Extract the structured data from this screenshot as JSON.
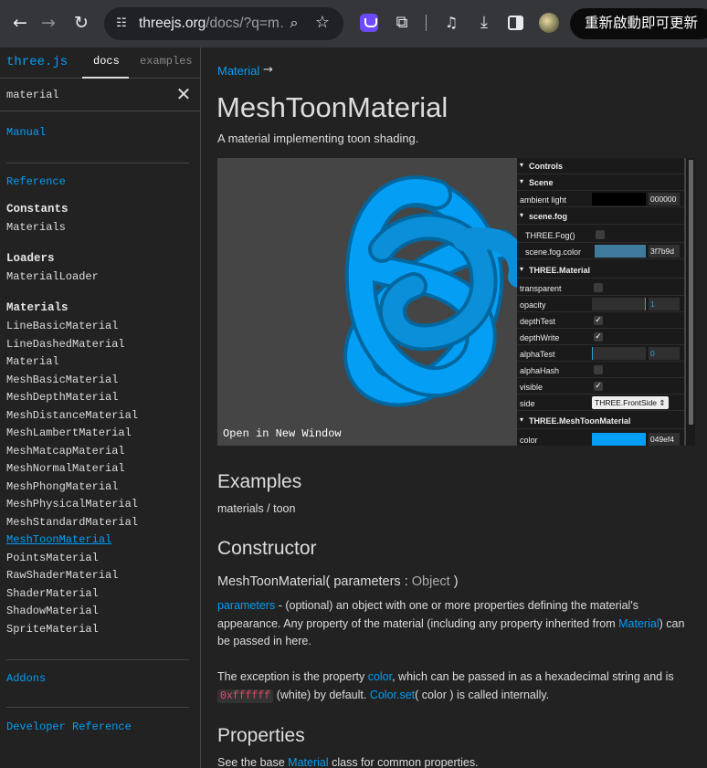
{
  "browser": {
    "url_host": "threejs.org",
    "url_path": "/docs/?q=m…",
    "update_button": "重新啟動即可更新"
  },
  "sidebar": {
    "logo": "three.js",
    "tabs": [
      "docs",
      "examples"
    ],
    "active_tab": "docs",
    "search_value": "material",
    "manual": "Manual",
    "reference": "Reference",
    "sections": [
      {
        "heading": "Constants",
        "items": [
          "Materials"
        ]
      },
      {
        "heading": "Loaders",
        "items": [
          "MaterialLoader"
        ]
      },
      {
        "heading": "Materials",
        "items": [
          "LineBasicMaterial",
          "LineDashedMaterial",
          "Material",
          "MeshBasicMaterial",
          "MeshDepthMaterial",
          "MeshDistanceMaterial",
          "MeshLambertMaterial",
          "MeshMatcapMaterial",
          "MeshNormalMaterial",
          "MeshPhongMaterial",
          "MeshPhysicalMaterial",
          "MeshStandardMaterial",
          "MeshToonMaterial",
          "PointsMaterial",
          "RawShaderMaterial",
          "ShaderMaterial",
          "ShadowMaterial",
          "SpriteMaterial"
        ]
      }
    ],
    "selected_item": "MeshToonMaterial",
    "addons": "Addons",
    "developer_reference": "Developer Reference"
  },
  "main": {
    "breadcrumb": "Material",
    "breadcrumb_arrow": "→",
    "title": "MeshToonMaterial",
    "description": "A material implementing toon shading.",
    "viewer": {
      "open_link": "Open in New Window",
      "mesh_color": "#049ef4",
      "background": "#454545"
    },
    "gui": {
      "controls": "Controls",
      "scene": "Scene",
      "ambient_light_label": "ambient light",
      "ambient_light_value": "000000",
      "fog_folder": "scene.fog",
      "fog_label": "THREE.Fog()",
      "fog_color_label": "scene.fog.color",
      "fog_color_value": "3f7b9d",
      "fog_color_hex": "#3f7b9d",
      "material_folder": "THREE.Material",
      "transparent": "transparent",
      "opacity": "opacity",
      "opacity_value": "1",
      "depth_test": "depthTest",
      "depth_write": "depthWrite",
      "alpha_test": "alphaTest",
      "alpha_test_value": "0",
      "alpha_hash": "alphaHash",
      "visible": "visible",
      "side": "side",
      "side_value": "THREE.FrontSide",
      "toon_folder": "THREE.MeshToonMaterial",
      "color_label": "color",
      "color_value": "049ef4",
      "color_hex": "#049ef4"
    },
    "examples_heading": "Examples",
    "examples_link": "materials / toon",
    "constructor_heading": "Constructor",
    "constructor_name": "MeshToonMaterial(",
    "constructor_param": "parameters",
    "constructor_colon": ":",
    "constructor_type": "Object",
    "constructor_close": ")",
    "param_link": "parameters",
    "param_text_1": " - (optional) an object with one or more properties defining the material's appearance. Any property of the material (including any property inherited from ",
    "param_material_link": "Material",
    "param_text_2": ") can be passed in here.",
    "exception_text_1": "The exception is the property ",
    "exception_color_link": "color",
    "exception_text_2": ", which can be passed in as a hexadecimal string and is ",
    "exception_code": "0xffffff",
    "exception_text_3": " (white) by default. ",
    "exception_colorset_link": "Color.set",
    "exception_text_4": "( color ) is called internally.",
    "properties_heading": "Properties",
    "properties_text_1": "See the base ",
    "properties_material_link": "Material",
    "properties_text_2": " class for common properties."
  }
}
